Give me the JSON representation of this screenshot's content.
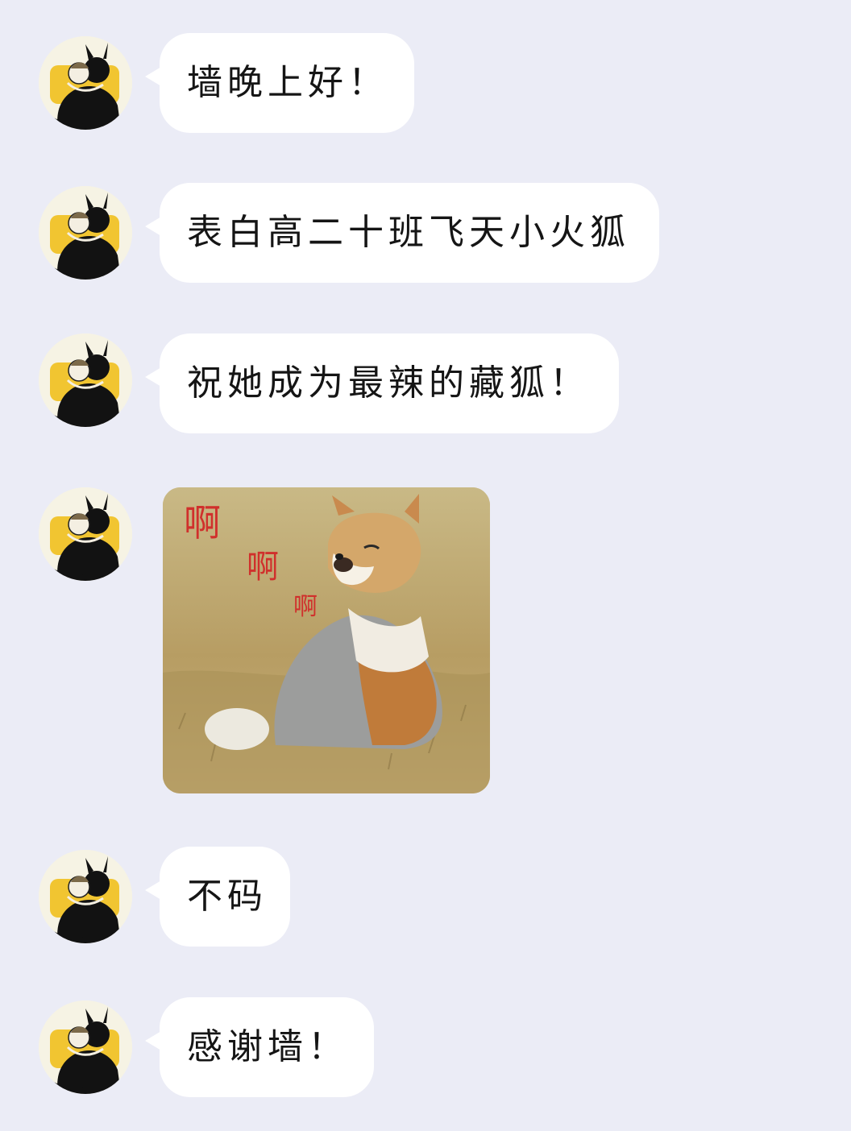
{
  "chat": {
    "messages": [
      {
        "type": "text",
        "text": "墙晚上好！"
      },
      {
        "type": "text",
        "text": "表白高二十班飞天小火狐"
      },
      {
        "type": "text",
        "text": "祝她成为最辣的藏狐！"
      },
      {
        "type": "image",
        "subject": "tibetan fox photo",
        "caption": [
          "啊",
          "啊",
          "啊"
        ]
      },
      {
        "type": "text",
        "text": "不码"
      },
      {
        "type": "text",
        "text": "感谢墙！"
      }
    ]
  },
  "colors": {
    "background": "#ebecf6",
    "bubble": "#ffffff",
    "text": "#151515",
    "caption": "#d0302c"
  }
}
